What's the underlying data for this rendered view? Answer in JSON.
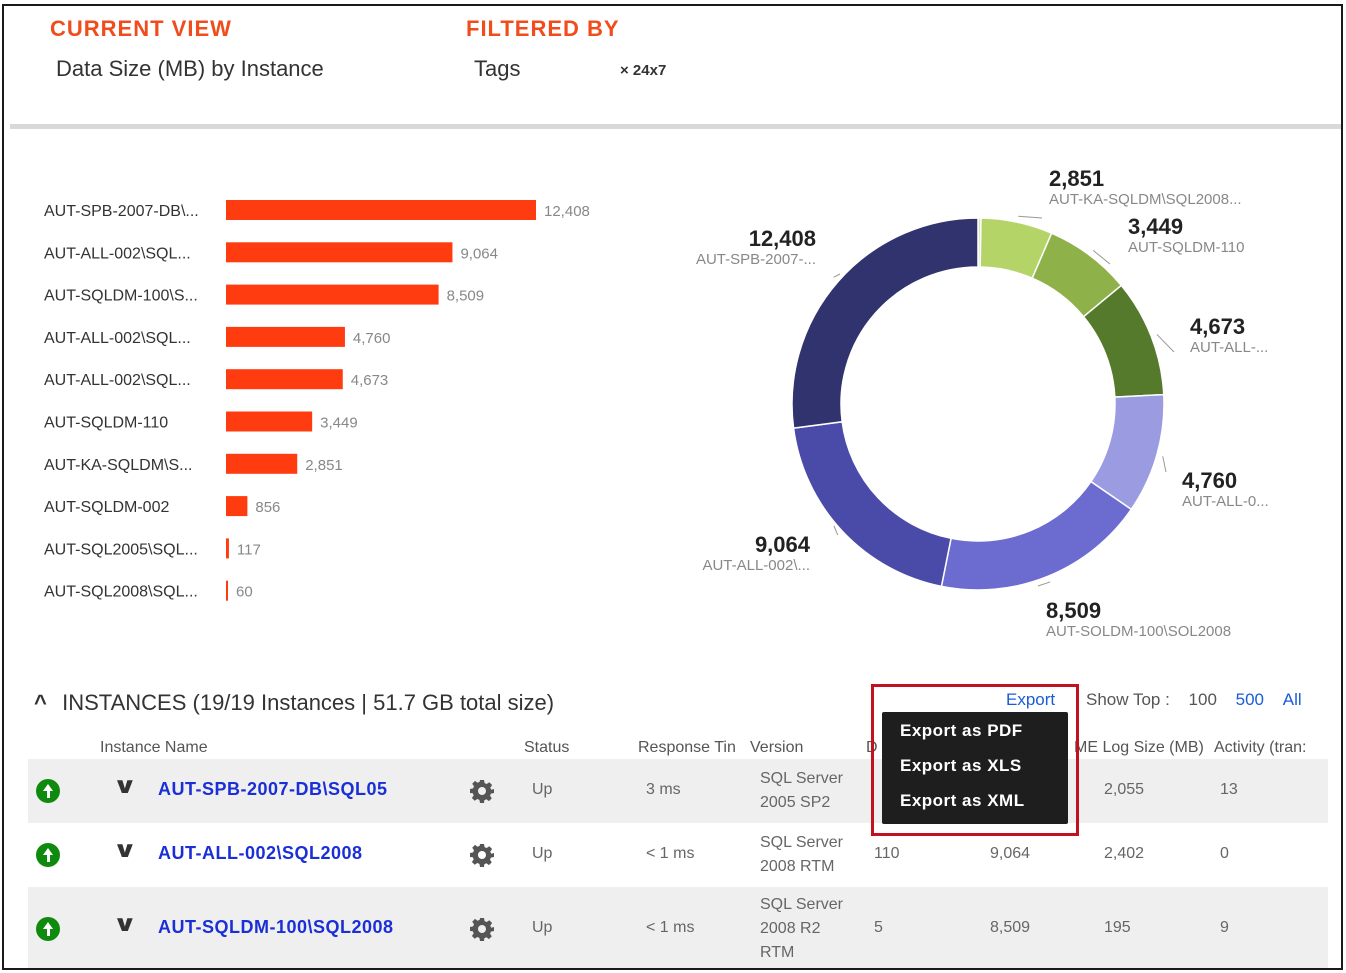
{
  "header": {
    "current_view_label": "CURRENT VIEW",
    "current_view_value": "Data Size (MB) by Instance",
    "filtered_by_label": "FILTERED BY",
    "filtered_by_value": "Tags",
    "filter_chip": "× 24x7"
  },
  "chart_data": [
    {
      "type": "bar",
      "orientation": "horizontal",
      "categories": [
        "AUT-SPB-2007-DB\\...",
        "AUT-ALL-002\\SQL...",
        "AUT-SQLDM-100\\S...",
        "AUT-ALL-002\\SQL...",
        "AUT-ALL-002\\SQL...",
        "AUT-SQLDM-110",
        "AUT-KA-SQLDM\\S...",
        "AUT-SQLDM-002",
        "AUT-SQL2005\\SQL...",
        "AUT-SQL2008\\SQL..."
      ],
      "values": [
        12408,
        9064,
        8509,
        4760,
        4673,
        3449,
        2851,
        856,
        117,
        60
      ],
      "value_labels": [
        "12,408",
        "9,064",
        "8,509",
        "4,760",
        "4,673",
        "3,449",
        "2,851",
        "856",
        "117",
        "60"
      ],
      "color": "#ff3c0f",
      "grid": false
    },
    {
      "type": "pie",
      "variant": "donut",
      "slices": [
        {
          "value": 117,
          "label": "",
          "color": "#d9e5b2",
          "callout": ""
        },
        {
          "value": 2851,
          "label": "AUT-KA-SQLDM\\SQL2008...",
          "value_label": "2,851",
          "color": "#b5d468",
          "callout": "top"
        },
        {
          "value": 3449,
          "label": "AUT-SQLDM-110",
          "value_label": "3,449",
          "color": "#8fb14a",
          "callout": "top-right"
        },
        {
          "value": 4673,
          "label": "AUT-ALL-...",
          "value_label": "4,673",
          "color": "#567a2c",
          "callout": "right"
        },
        {
          "value": 4760,
          "label": "AUT-ALL-0...",
          "value_label": "4,760",
          "color": "#9b9be2",
          "callout": "right"
        },
        {
          "value": 8509,
          "label": "AUT-SQLDM-100\\SQL2008",
          "value_label": "8,509",
          "color": "#6b6bd0",
          "callout": "bottom"
        },
        {
          "value": 9064,
          "label": "AUT-ALL-002\\...",
          "value_label": "9,064",
          "color": "#4a4aa8",
          "callout": "left"
        },
        {
          "value": 12408,
          "label": "AUT-SPB-2007-...",
          "value_label": "12,408",
          "color": "#31336e",
          "callout": "top-left"
        }
      ]
    }
  ],
  "instances": {
    "caret": "^",
    "title": "INSTANCES (19/19 Instances | 51.7 GB total size)",
    "export_label": "Export",
    "show_top_label": "Show Top :",
    "show_top_options": [
      "100",
      "500",
      "All"
    ],
    "columns": {
      "name": "Instance Name",
      "status": "Status",
      "response": "Response Tin",
      "version": "Version",
      "col5": "D",
      "col6": "",
      "log": "ME Log Size (MB)",
      "activity": "Activity (tran:"
    },
    "rows": [
      {
        "name": "AUT-SPB-2007-DB\\SQL05",
        "status": "Up",
        "response": "3 ms",
        "version_1": "SQL Server",
        "version_2": "2005 SP2",
        "version_3": "",
        "col5": "",
        "col6": "",
        "log": "2,055",
        "activity": "13"
      },
      {
        "name": "AUT-ALL-002\\SQL2008",
        "status": "Up",
        "response": "< 1 ms",
        "version_1": "SQL Server",
        "version_2": "2008 RTM",
        "version_3": "",
        "col5": "110",
        "col6": "9,064",
        "log": "2,402",
        "activity": "0"
      },
      {
        "name": "AUT-SQLDM-100\\SQL2008",
        "status": "Up",
        "response": "< 1 ms",
        "version_1": "SQL Server",
        "version_2": "2008 R2",
        "version_3": "RTM",
        "col5": "5",
        "col6": "8,509",
        "log": "195",
        "activity": "9"
      }
    ]
  },
  "export_menu": {
    "items": [
      "Export as PDF",
      "Export as XLS",
      "Export as XML"
    ],
    "highlight_color": "#c1121f"
  },
  "colors": {
    "accent": "#f04c1c",
    "link": "#1a2fd6",
    "status_up": "#0e8a0e"
  }
}
